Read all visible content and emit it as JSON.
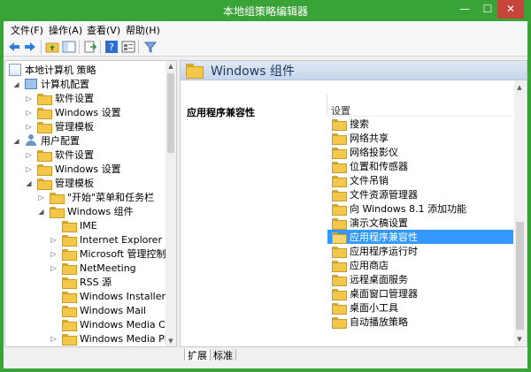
{
  "window": {
    "title": "本地组策略编辑器",
    "controls": {
      "minimize": "—",
      "maximize": "☐",
      "close": "✕"
    }
  },
  "menubar": {
    "items": [
      "文件(F)",
      "操作(A)",
      "查看(V)",
      "帮助(H)"
    ]
  },
  "toolbar": {
    "buttons": [
      "back-icon",
      "forward-icon",
      "up-folder-icon",
      "show-hide-tree-icon",
      "export-list-icon",
      "help-icon",
      "properties-icon",
      "filter-icon"
    ]
  },
  "tree": {
    "items": [
      {
        "label": "本地计算机 策略",
        "icon": "policy-doc-icon",
        "expander": ""
      },
      {
        "label": "计算机配置",
        "icon": "computer-icon",
        "expander": "◢"
      },
      {
        "label": "软件设置",
        "icon": "folder-icon",
        "expander": "▷"
      },
      {
        "label": "Windows 设置",
        "icon": "folder-icon",
        "expander": "▷"
      },
      {
        "label": "管理模板",
        "icon": "folder-icon",
        "expander": "▷"
      },
      {
        "label": "用户配置",
        "icon": "user-icon",
        "expander": "◢"
      },
      {
        "label": "软件设置",
        "icon": "folder-icon",
        "expander": "▷"
      },
      {
        "label": "Windows 设置",
        "icon": "folder-icon",
        "expander": "▷"
      },
      {
        "label": "管理模板",
        "icon": "folder-icon",
        "expander": "◢"
      },
      {
        "label": "\"开始\"菜单和任务栏",
        "icon": "folder-icon",
        "expander": "▷"
      },
      {
        "label": "Windows 组件",
        "icon": "folder-icon",
        "expander": "◢"
      },
      {
        "label": "IME",
        "icon": "folder-icon",
        "expander": ""
      },
      {
        "label": "Internet Explorer",
        "icon": "folder-icon",
        "expander": "▷"
      },
      {
        "label": "Microsoft 管理控制台",
        "icon": "folder-icon",
        "expander": "▷"
      },
      {
        "label": "NetMeeting",
        "icon": "folder-icon",
        "expander": "▷"
      },
      {
        "label": "RSS 源",
        "icon": "folder-icon",
        "expander": ""
      },
      {
        "label": "Windows Installer",
        "icon": "folder-icon",
        "expander": ""
      },
      {
        "label": "Windows Mail",
        "icon": "folder-icon",
        "expander": ""
      },
      {
        "label": "Windows Media Cent",
        "icon": "folder-icon",
        "expander": ""
      },
      {
        "label": "Windows Media Playe",
        "icon": "folder-icon",
        "expander": "▷"
      }
    ]
  },
  "rightpane": {
    "header": "Windows 组件",
    "description_title": "应用程序兼容性",
    "column_header": "设置",
    "settings": [
      "搜索",
      "网络共享",
      "网络投影仪",
      "位置和传感器",
      "文件吊销",
      "文件资源管理器",
      "向 Windows 8.1 添加功能",
      "演示文稿设置",
      "应用程序兼容性",
      "应用程序运行时",
      "应用商店",
      "远程桌面服务",
      "桌面窗口管理器",
      "桌面小工具",
      "自动播放策略"
    ],
    "selected_setting": "应用程序兼容性"
  },
  "tabs": {
    "extended": "扩展",
    "standard": "标准"
  }
}
